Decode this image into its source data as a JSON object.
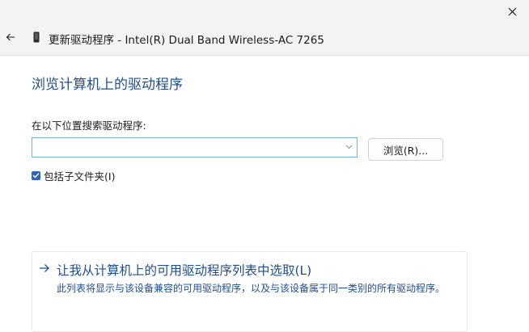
{
  "window": {
    "title": "更新驱动程序 - Intel(R) Dual Band Wireless-AC 7265"
  },
  "page": {
    "heading": "浏览计算机上的驱动程序",
    "search_label": "在以下位置搜索驱动程序:",
    "path_input_value": "",
    "browse_label": "浏览(R)...",
    "include_subfolders": {
      "label": "包括子文件夹(I)",
      "checked": true
    },
    "pick_option": {
      "title": "让我从计算机上的可用驱动程序列表中选取(L)",
      "description": "此列表将显示与该设备兼容的可用驱动程序，以及与该设备属于同一类别的所有驱动程序。"
    }
  },
  "colors": {
    "accent": "#1f4e8c",
    "checkbox": "#2b64b8",
    "input_border": "#7bb1d6",
    "titlebar_bg": "#f3f3f3"
  },
  "icons": [
    "back-arrow-icon",
    "device-icon",
    "close-icon",
    "chevron-down-icon",
    "check-icon",
    "right-arrow-icon"
  ]
}
